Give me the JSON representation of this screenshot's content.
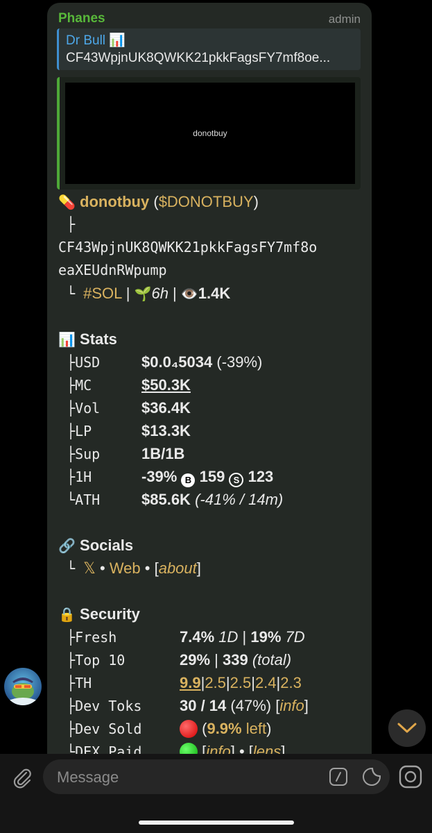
{
  "message": {
    "sender": "Phanes",
    "role": "admin",
    "reply": {
      "name": "Dr Bull 📊",
      "text": "CF43WpjnUK8QWKK21pkkFagsFY7mf8oe..."
    },
    "preview_label": "donotbuy"
  },
  "token": {
    "emoji": "💊",
    "name": "donotbuy",
    "open": " (",
    "ticker": "$DONOTBUY",
    "close": ")",
    "branch": "├",
    "address_line1": "CF43WpjnUK8QWKK21pkkFagsFY7mf8o",
    "address_line2": "eaXEUdnRWpump",
    "tree_end": "└",
    "chain": "#SOL",
    "sep1": " | ",
    "sprout": "🌱",
    "age": "6h",
    "sep2": " | ",
    "eye": "👁️",
    "views": "1.4K"
  },
  "stats": {
    "icon": "📊",
    "title": "Stats",
    "rows": [
      {
        "tree": "├",
        "label": "USD",
        "value": "$0.0₄5034",
        "extra": " (-39%)"
      },
      {
        "tree": "├",
        "label": "MC",
        "value": "$50.3K"
      },
      {
        "tree": "├",
        "label": "Vol",
        "value": "$36.4K"
      },
      {
        "tree": "├",
        "label": "LP",
        "value": "$13.3K"
      },
      {
        "tree": "├",
        "label": "Sup",
        "value": "1B/1B"
      }
    ],
    "h1": {
      "tree": "├",
      "label": "1H",
      "pct": "-39%",
      "buy_icon": "B",
      "buys": "159",
      "sell_icon": "S",
      "sells": "123"
    },
    "ath": {
      "tree": "└",
      "label": "ATH",
      "value": "$85.6K",
      "extra": "(-41% / 14m)"
    }
  },
  "socials": {
    "icon": "🔗",
    "title": "Socials",
    "tree": "└",
    "x": "𝕏",
    "dot1": " • ",
    "web": "Web",
    "dot2": " • [",
    "about": "about",
    "end": "]"
  },
  "security": {
    "icon": "🔒",
    "title": "Security",
    "fresh": {
      "tree": "├",
      "label": "Fresh",
      "v1": "7.4%",
      "p1": "1D",
      "sep": " | ",
      "v2": "19%",
      "p2": "7D"
    },
    "top10": {
      "tree": "├",
      "label": "Top 10",
      "v1": "29%",
      "sep": " | ",
      "v2": "339",
      "note": "(total)"
    },
    "th": {
      "tree": "├",
      "label": "TH",
      "values": [
        "9.9",
        "2.5",
        "2.5",
        "2.4",
        "2.3"
      ],
      "sep": "|"
    },
    "devtoks": {
      "tree": "├",
      "label": "Dev Toks",
      "value": "30 / 14",
      "pct": " (47%)",
      "open": "  [",
      "link": "info",
      "close": "]"
    },
    "devsold": {
      "tree": "├",
      "label": "Dev Sold",
      "open": " (",
      "value": "9.9%",
      "left": " left",
      "close": ")"
    },
    "dexpaid": {
      "tree": "└",
      "label": "DEX Paid",
      "open1": " [",
      "info": "info",
      "mid": "] • [",
      "lens": "lens",
      "close": "]"
    }
  },
  "composer": {
    "placeholder": "Message"
  },
  "colors": {
    "accent_green": "#58b83a",
    "link_gold": "#d9b25f",
    "reply_blue": "#4da7e8",
    "bubble": "#242925"
  }
}
